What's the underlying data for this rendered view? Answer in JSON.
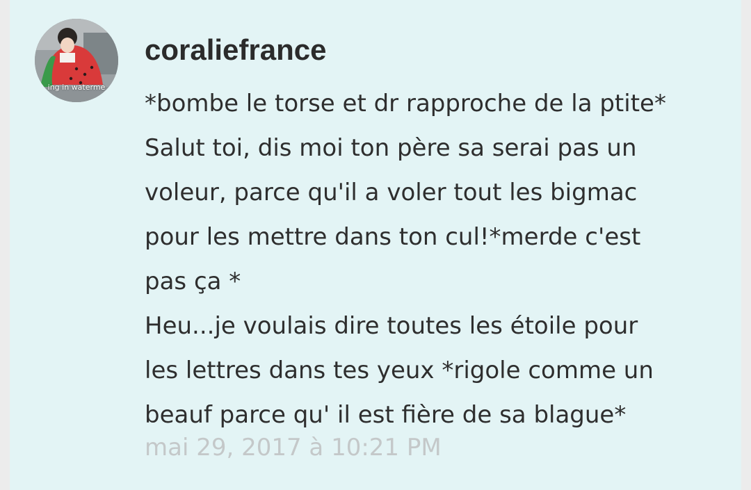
{
  "comment": {
    "avatar": {
      "icon": "user-avatar-watermelon-blanket",
      "caption": "ing in waterme"
    },
    "username": "coraliefrance",
    "lines": [
      "*bombe le torse et dr rapproche de la ptite*",
      "Salut toi, dis moi ton père sa serai pas un",
      "voleur, parce qu'il a voler tout les bigmac",
      "pour les mettre dans ton cul!*merde c'est",
      "pas ça *",
      "Heu...je voulais dire toutes les étoile pour",
      "les lettres dans tes yeux *rigole comme un",
      "beauf parce qu' il est fière de sa blague*"
    ],
    "timestamp": "mai 29, 2017 à 10:21 PM"
  },
  "colors": {
    "card_background": "#e3f4f5",
    "page_background": "#ececec",
    "text": "#2e2e2e",
    "timestamp": "#c4c8c9"
  }
}
